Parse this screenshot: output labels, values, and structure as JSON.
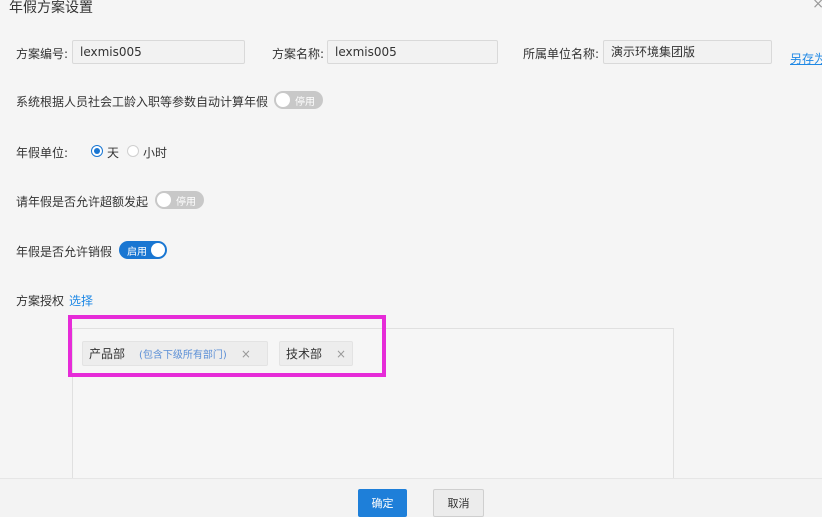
{
  "dialog": {
    "title": "年假方案设置",
    "close_symbol": "×"
  },
  "form": {
    "code": {
      "label": "方案编号:",
      "value": "lexmis005"
    },
    "name": {
      "label": "方案名称:",
      "value": "lexmis005"
    },
    "unit": {
      "label": "所属单位名称:",
      "value": "演示环境集团版"
    },
    "save_as_label": "另存为",
    "auto_calc": {
      "label": "系统根据人员社会工龄入职等参数自动计算年假",
      "toggle_text": "停用",
      "enabled": false
    },
    "leave_unit": {
      "label": "年假单位:",
      "options": [
        {
          "label": "天",
          "checked": true
        },
        {
          "label": "小时",
          "checked": false
        }
      ]
    },
    "over_quota": {
      "label": "请年假是否允许超额发起",
      "toggle_text": "停用",
      "enabled": false
    },
    "allow_cancel": {
      "label": "年假是否允许销假",
      "toggle_text": "启用",
      "enabled": true
    },
    "authorization": {
      "label": "方案授权",
      "select_label": "选择",
      "tags": [
        {
          "name": "产品部",
          "note": "(包含下级所有部门)",
          "remove": "×"
        },
        {
          "name": "技术部",
          "remove": "×"
        }
      ]
    }
  },
  "footer": {
    "confirm_label": "确定",
    "cancel_label": "取消"
  },
  "colors": {
    "accent": "#1976d2",
    "highlight": "#e62bd8",
    "toggle_off": "#c8c8c8"
  }
}
